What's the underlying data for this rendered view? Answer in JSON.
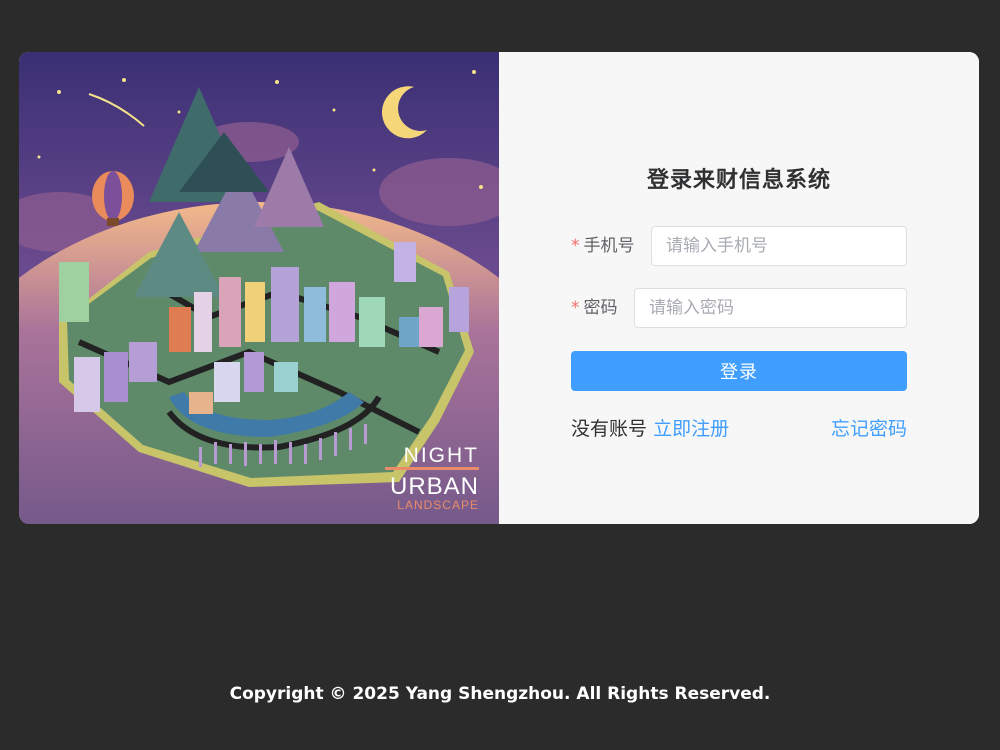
{
  "login": {
    "title": "登录来财信息系统",
    "phone_label": "手机号",
    "phone_placeholder": "请输入手机号",
    "password_label": "密码",
    "password_placeholder": "请输入密码",
    "required_mark": "*",
    "login_button": "登录",
    "no_account_text": "没有账号",
    "register_link": "立即注册",
    "forgot_link": "忘记密码"
  },
  "illustration": {
    "line1": "NIGHT",
    "line2": "URBAN",
    "line3": "LANDSCAPE"
  },
  "footer": {
    "copyright": "Copyright © 2025 Yang Shengzhou. All Rights Reserved."
  },
  "colors": {
    "background": "#2b2b2b",
    "primary": "#409eff",
    "required": "#f56c6c",
    "card": "#f7f7f7"
  }
}
